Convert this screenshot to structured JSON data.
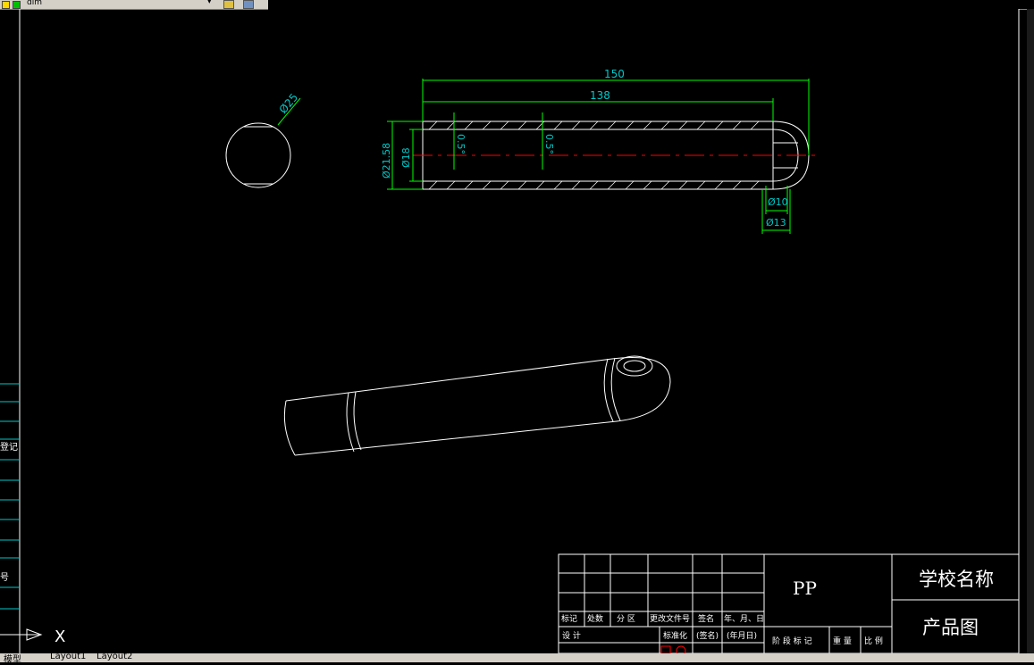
{
  "toolbar": {
    "layer_name": "dim",
    "dropdown_arrow": "▾",
    "icons": [
      "layer-state-icon",
      "layer-previous-icon"
    ]
  },
  "drawing": {
    "dims": {
      "overall_length": "150",
      "inner_length": "138",
      "circle_dia": "Ø25",
      "outer_dia": "Ø21.58",
      "bore_dia": "Ø18",
      "draft_left": "0.5°",
      "draft_right": "0.5°",
      "hole_dia": "Ø10",
      "hole_outer_dia": "Ø13"
    },
    "colors": {
      "geometry": "#ffffff",
      "dimension": "#00ff00",
      "dim_text": "#00c8c8",
      "centerline": "#ff0000",
      "border": "#ffffff",
      "title_text": "#ffffff"
    }
  },
  "left_panel": {
    "label_upper": "登记",
    "label_lower": "号"
  },
  "ucs": {
    "x_label": "X"
  },
  "title_block": {
    "material": "PP",
    "school": "学校名称",
    "drawing_name": "产品图",
    "headers": [
      "标记",
      "处数",
      "分 区",
      "更改文件号",
      "签名",
      "年、月、日"
    ],
    "row_design": [
      "设 计",
      "标准化",
      "(签名)",
      "(年月日)"
    ],
    "bottom_labels": [
      "阶 段 标 记",
      "重 量",
      "比 例"
    ]
  },
  "layout_tabs": [
    "模型",
    "Layout1",
    "Layout2"
  ]
}
